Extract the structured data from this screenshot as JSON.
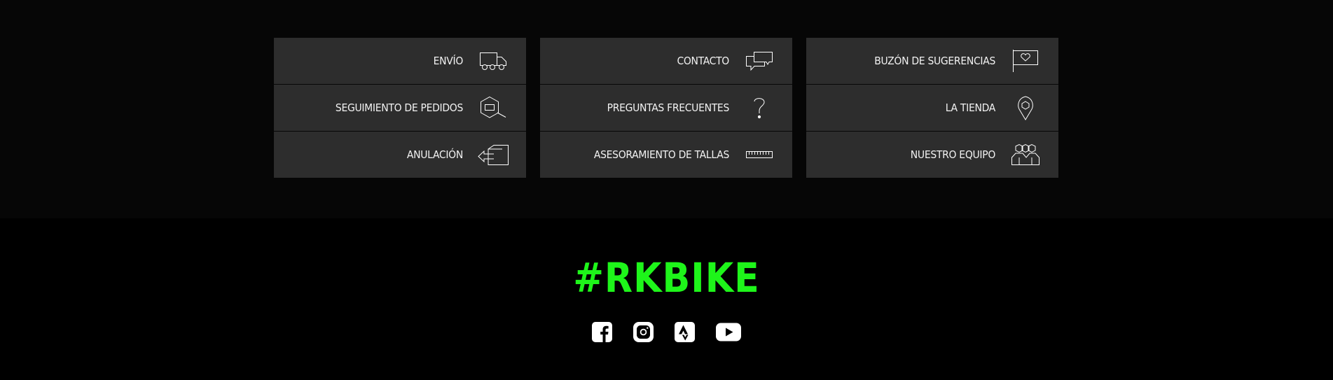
{
  "links": [
    {
      "label": "ENVÍO",
      "icon": "delivery-truck-icon"
    },
    {
      "label": "CONTACTO",
      "icon": "chat-bubbles-icon"
    },
    {
      "label": "BUZÓN DE SUGERENCIAS",
      "icon": "heart-flag-icon"
    },
    {
      "label": "SEGUIMIENTO DE PEDIDOS",
      "icon": "package-search-icon"
    },
    {
      "label": "PREGUNTAS FRECUENTES",
      "icon": "question-mark-icon"
    },
    {
      "label": "LA TIENDA",
      "icon": "location-pin-icon"
    },
    {
      "label": "ANULACIÓN",
      "icon": "return-box-icon"
    },
    {
      "label": "ASESORAMIENTO DE TALLAS",
      "icon": "ruler-icon"
    },
    {
      "label": "NUESTRO EQUIPO",
      "icon": "team-icon"
    }
  ],
  "footer": {
    "hashtag": "#RKBIKE",
    "hashtag_color": "#1ef51a",
    "social": [
      {
        "name": "facebook-icon"
      },
      {
        "name": "instagram-icon"
      },
      {
        "name": "strava-icon"
      },
      {
        "name": "youtube-icon"
      }
    ]
  },
  "colors": {
    "card_background": "#2d2d2d",
    "page_background": "#000000",
    "text": "#f2f2f2"
  }
}
